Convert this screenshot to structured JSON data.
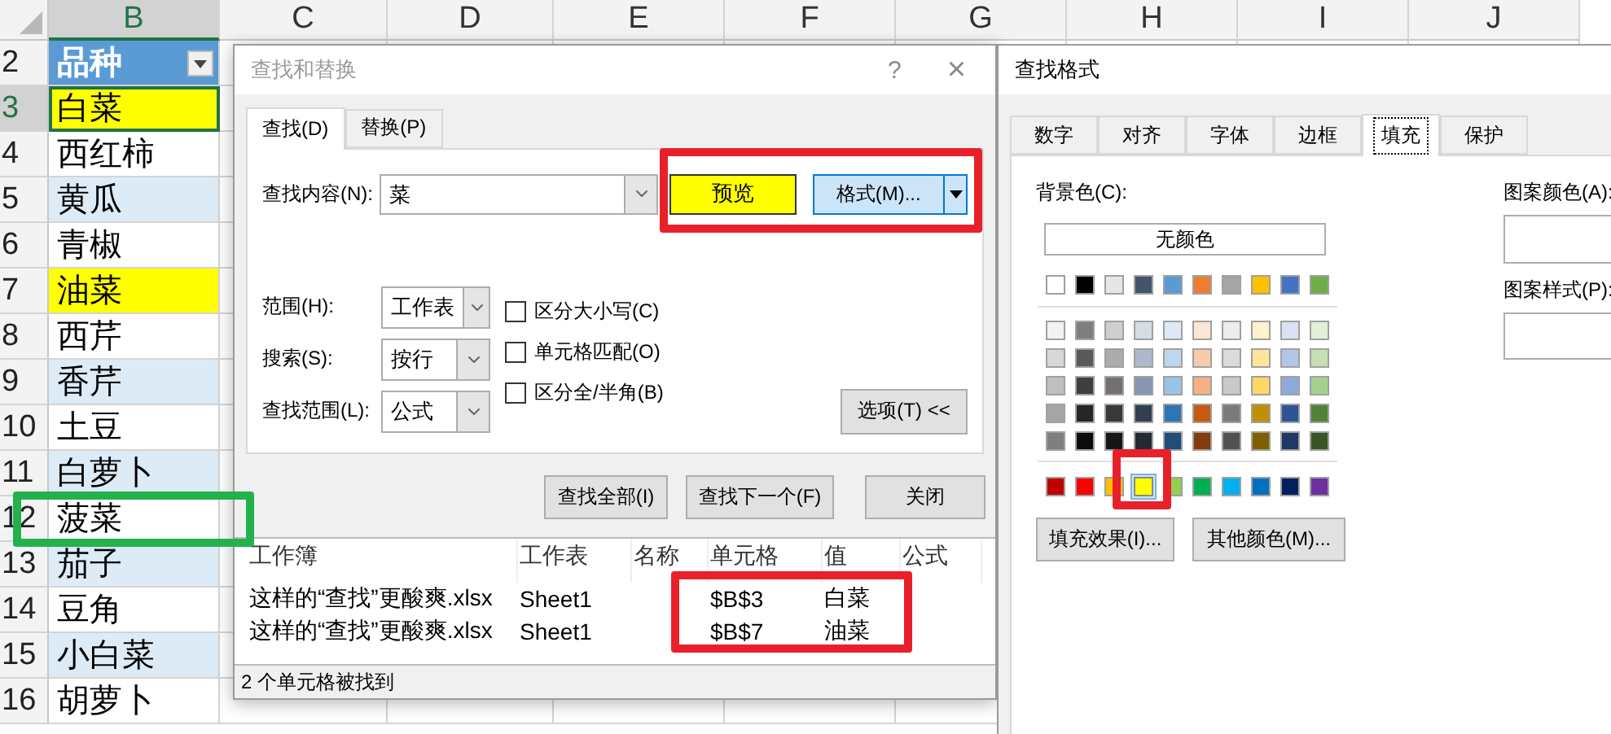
{
  "sheet": {
    "columns": [
      {
        "label": "B",
        "selected": true
      },
      {
        "label": "C",
        "selected": false
      },
      {
        "label": "D",
        "selected": false
      },
      {
        "label": "E",
        "selected": false
      },
      {
        "label": "F",
        "selected": false
      },
      {
        "label": "G",
        "selected": false
      },
      {
        "label": "H",
        "selected": false
      },
      {
        "label": "I",
        "selected": false
      },
      {
        "label": "J",
        "selected": false
      }
    ],
    "rows": [
      {
        "number": "2",
        "kind": "header",
        "selected": false,
        "color": "#5b9bd5",
        "text": "品种"
      },
      {
        "number": "3",
        "kind": "data",
        "selected": true,
        "color": "#ffff00",
        "text": "白菜"
      },
      {
        "number": "4",
        "kind": "data",
        "selected": false,
        "color": "#ffffff",
        "text": "西红柿"
      },
      {
        "number": "5",
        "kind": "data",
        "selected": false,
        "color": "#ddebf7",
        "text": "黄瓜"
      },
      {
        "number": "6",
        "kind": "data",
        "selected": false,
        "color": "#ffffff",
        "text": "青椒"
      },
      {
        "number": "7",
        "kind": "data",
        "selected": false,
        "color": "#ffff00",
        "text": "油菜"
      },
      {
        "number": "8",
        "kind": "data",
        "selected": false,
        "color": "#ffffff",
        "text": "西芹"
      },
      {
        "number": "9",
        "kind": "data",
        "selected": false,
        "color": "#ddebf7",
        "text": "香芹"
      },
      {
        "number": "10",
        "kind": "data",
        "selected": false,
        "color": "#ffffff",
        "text": "土豆"
      },
      {
        "number": "11",
        "kind": "data",
        "selected": false,
        "color": "#ddebf7",
        "text": "白萝卜"
      },
      {
        "number": "12",
        "kind": "data",
        "selected": false,
        "color": "#ffffff",
        "text": "菠菜"
      },
      {
        "number": "13",
        "kind": "data",
        "selected": false,
        "color": "#ddebf7",
        "text": "茄子"
      },
      {
        "number": "14",
        "kind": "data",
        "selected": false,
        "color": "#ffffff",
        "text": "豆角"
      },
      {
        "number": "15",
        "kind": "data",
        "selected": false,
        "color": "#ddebf7",
        "text": "小白菜"
      },
      {
        "number": "16",
        "kind": "data",
        "selected": false,
        "color": "#ffffff",
        "text": "胡萝卜"
      }
    ]
  },
  "find_dialog": {
    "title": "查找和替换",
    "help": "?",
    "close": "×",
    "tabs": [
      {
        "label": "查找(D)",
        "selected": true
      },
      {
        "label": "替换(P)",
        "selected": false
      }
    ],
    "find_label": "查找内容(N):",
    "find_value": "菜",
    "preview": {
      "label": "预览",
      "color": "#ffff00"
    },
    "format_button": "格式(M)...",
    "options": [
      {
        "label": "范围(H):",
        "value": "工作表"
      },
      {
        "label": "搜索(S):",
        "value": "按行"
      },
      {
        "label": "查找范围(L):",
        "value": "公式"
      }
    ],
    "checkboxes": [
      {
        "label": "区分大小写(C)",
        "checked": false
      },
      {
        "label": "单元格匹配(O)",
        "checked": false
      },
      {
        "label": "区分全/半角(B)",
        "checked": false
      }
    ],
    "options_button": "选项(T) <<",
    "buttons": [
      "查找全部(I)",
      "查找下一个(F)",
      "关闭"
    ],
    "results": {
      "columns": [
        "工作簿",
        "工作表",
        "名称",
        "单元格",
        "值",
        "公式"
      ],
      "rows": [
        {
          "workbook": "这样的“查找”更酸爽.xlsx",
          "sheet": "Sheet1",
          "cell": "$B$3",
          "value": "白菜"
        },
        {
          "workbook": "这样的“查找”更酸爽.xlsx",
          "sheet": "Sheet1",
          "cell": "$B$7",
          "value": "油菜"
        }
      ]
    },
    "status": "2 个单元格被找到"
  },
  "format_dialog": {
    "title": "查找格式",
    "tabs": [
      {
        "label": "数字",
        "selected": false
      },
      {
        "label": "对齐",
        "selected": false
      },
      {
        "label": "字体",
        "selected": false
      },
      {
        "label": "边框",
        "selected": false
      },
      {
        "label": "填充",
        "selected": true
      },
      {
        "label": "保护",
        "selected": false
      }
    ],
    "background_label": "背景色(C):",
    "no_color": "无颜色",
    "theme_colors": [
      {
        "color": "#ffffff"
      },
      {
        "color": "#000000"
      },
      {
        "color": "#e7e6e6"
      },
      {
        "color": "#44546a"
      },
      {
        "color": "#5b9bd5"
      },
      {
        "color": "#ed7d31"
      },
      {
        "color": "#a5a5a5"
      },
      {
        "color": "#ffc000"
      },
      {
        "color": "#4472c4"
      },
      {
        "color": "#70ad47"
      }
    ],
    "tints": [
      [
        {
          "color": "#f2f2f2"
        },
        {
          "color": "#7f7f7f"
        },
        {
          "color": "#d0cece"
        },
        {
          "color": "#d6dce4"
        },
        {
          "color": "#deebf6"
        },
        {
          "color": "#fbe5d5"
        },
        {
          "color": "#ededed"
        },
        {
          "color": "#fff2cc"
        },
        {
          "color": "#d9e2f3"
        },
        {
          "color": "#e2efd9"
        }
      ],
      [
        {
          "color": "#d8d8d8"
        },
        {
          "color": "#595959"
        },
        {
          "color": "#aeabab"
        },
        {
          "color": "#adb9ca"
        },
        {
          "color": "#bdd7ee"
        },
        {
          "color": "#f7cbac"
        },
        {
          "color": "#dbdbdb"
        },
        {
          "color": "#fee599"
        },
        {
          "color": "#b4c6e7"
        },
        {
          "color": "#c5e0b3"
        }
      ],
      [
        {
          "color": "#bfbfbf"
        },
        {
          "color": "#3f3f3f"
        },
        {
          "color": "#757070"
        },
        {
          "color": "#8496b0"
        },
        {
          "color": "#9cc3e5"
        },
        {
          "color": "#f4b183"
        },
        {
          "color": "#c9c9c9"
        },
        {
          "color": "#ffd965"
        },
        {
          "color": "#8eaadb"
        },
        {
          "color": "#a8d08d"
        }
      ],
      [
        {
          "color": "#a5a5a5"
        },
        {
          "color": "#262626"
        },
        {
          "color": "#3a3838"
        },
        {
          "color": "#323f4f"
        },
        {
          "color": "#2e75b5"
        },
        {
          "color": "#c55a11"
        },
        {
          "color": "#7b7b7b"
        },
        {
          "color": "#bf9000"
        },
        {
          "color": "#2f5496"
        },
        {
          "color": "#538135"
        }
      ],
      [
        {
          "color": "#7f7f7f"
        },
        {
          "color": "#0c0c0c"
        },
        {
          "color": "#171616"
        },
        {
          "color": "#222a35"
        },
        {
          "color": "#1e4e79"
        },
        {
          "color": "#833c0b"
        },
        {
          "color": "#525252"
        },
        {
          "color": "#7f6000"
        },
        {
          "color": "#1f3864"
        },
        {
          "color": "#375623"
        }
      ]
    ],
    "standard_colors": [
      {
        "color": "#c00000",
        "selected": false
      },
      {
        "color": "#ff0000",
        "selected": false
      },
      {
        "color": "#ffc000",
        "selected": false
      },
      {
        "color": "#ffff00",
        "selected": true
      },
      {
        "color": "#92d050",
        "selected": false
      },
      {
        "color": "#00b050",
        "selected": false
      },
      {
        "color": "#00b0f0",
        "selected": false
      },
      {
        "color": "#0070c0",
        "selected": false
      },
      {
        "color": "#002060",
        "selected": false
      },
      {
        "color": "#7030a0",
        "selected": false
      }
    ],
    "buttons": [
      "填充效果(I)...",
      "其他颜色(M)..."
    ],
    "pattern_color_label": "图案颜色(A):",
    "pattern_style_label": "图案样式(P):"
  }
}
